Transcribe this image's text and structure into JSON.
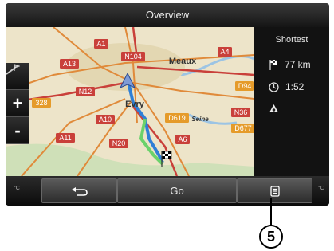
{
  "window": {
    "title": "Overview"
  },
  "map": {
    "places": [
      "Meaux",
      "Evry",
      "Seine"
    ],
    "road_labels": [
      "A1",
      "N104",
      "A4",
      "A13",
      "N12",
      "A10",
      "N20",
      "D619",
      "A6",
      "A11",
      "328",
      "D94",
      "N36",
      "D677"
    ]
  },
  "route_summary": {
    "mode": "Shortest",
    "distance": "77 km",
    "duration": "1:52"
  },
  "toolbar": {
    "back_icon": "back-arrow-icon",
    "go_label": "Go",
    "menu_icon": "list-menu-icon"
  },
  "units": {
    "left": "°C",
    "right": "°C"
  },
  "callout": {
    "label": "5"
  },
  "colors": {
    "route_blue": "#2f7fd6",
    "route_green": "#6bd26b",
    "road_red": "#d9534f",
    "road_orange": "#e59b2a"
  }
}
